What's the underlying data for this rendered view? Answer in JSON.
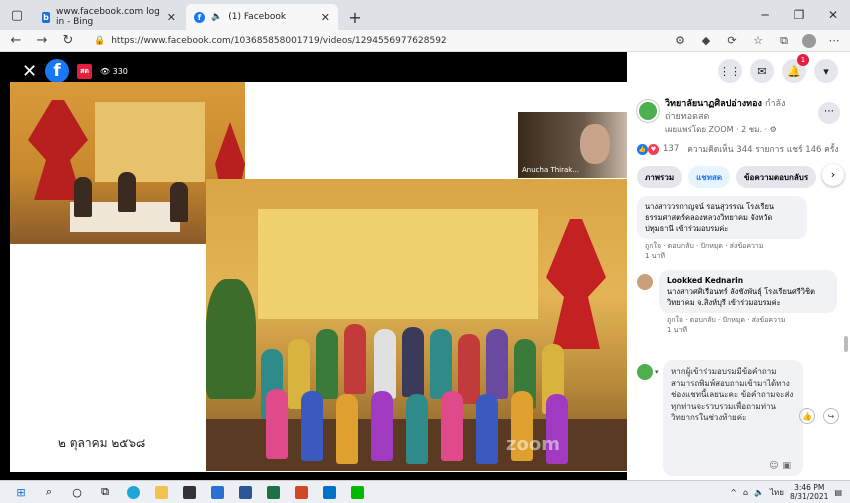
{
  "tabs": [
    {
      "title": "www.facebook.com log in - Bing",
      "active": false
    },
    {
      "title": "(1) Facebook",
      "active": true
    }
  ],
  "url": "https://www.facebook.com/103685858001719/videos/1294556977628592",
  "viewer": {
    "live_label": "สด",
    "viewer_count": "330",
    "camera_name": "Anucha Thirak...",
    "slide_date": "๒ ตุลาคม ๒๕๖๘",
    "watermark": "zoom"
  },
  "panel": {
    "notif_count": "1",
    "page_name": "วิทยาลัยนาฏศิลปอ่างทอง",
    "page_status": "กำลังถ่ายทอดสด",
    "sub": "เผยแพร่โดย ZOOM · 2 ชม. · ⚙",
    "reactions": "137",
    "comments_shares": "ความคิดเห็น 344 รายการ  แชร์ 146 ครั้ง",
    "tab_overview": "ภาพรวม",
    "tab_chat": "แชทสด",
    "tab_qa": "ข้อความตอบกลับร",
    "comment1_text": "นางสาววรกาญจน์ รอนสุวรรณ โรงเรียนธรรมศาสตร์คลองหลวงวิทยาคม จังหวัดปทุมธานี เข้าร่วมอบรมค่ะ",
    "comment1_meta": "ถูกใจ · ตอบกลับ · ปักหมุด · ส่งข้อความ",
    "comment1_time": "1 นาที",
    "comment2_name": "Lookked Kednarin",
    "comment2_text": "นางสาวศศิเรือนทร์ ลังชังพันธุ์ โรงเรียนศรีวิชิตวิทยาคม จ.สิงห์บุรี เข้าร่วมอบรมค่ะ",
    "comment2_meta": "ถูกใจ · ตอบกลับ · ปักหมุด · ส่งข้อความ",
    "comment2_time": "1 นาที",
    "input_text": "หากผู้เข้าร่วมอบรมมีข้อคำถาม สามารถพิมพ์สอบถามเข้ามาได้ทางช่องแชทนี้เลยนะคะ ข้อคำถามจะส่งทุกท่านจะรวบรวมเพื่อถามท่านวิทยากรในช่วงท้ายค่ะ"
  },
  "taskbar": {
    "lang": "ไทย",
    "time": "3:46 PM",
    "date": "8/31/2021"
  }
}
